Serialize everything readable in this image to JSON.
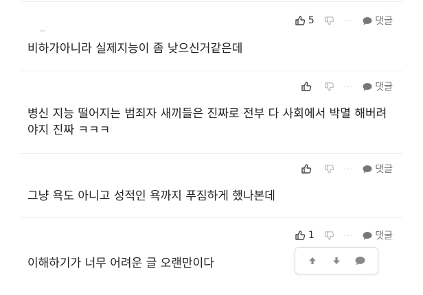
{
  "comments": [
    {
      "like_count": "5",
      "reply_label": "댓글",
      "more_label": "···",
      "text": "비하가아니라 실제지능이 좀 낮으신거같은데"
    },
    {
      "like_count": "",
      "reply_label": "댓글",
      "more_label": "···",
      "text": "병신 지능 떨어지는 범죄자 새끼들은 진짜로 전부 다 사회에서 박멸 해버려야지 진짜 ㅋㅋㅋ"
    },
    {
      "like_count": "",
      "reply_label": "댓글",
      "more_label": "···",
      "text": "그냥 욕도 아니고 성적인 욕까지 푸짐하게 했나본데"
    },
    {
      "like_count": "1",
      "reply_label": "댓글",
      "more_label": "···",
      "text": "이해하기가 너무 어려운 글 오랜만이다"
    }
  ],
  "floating_toolbar": {
    "up": "arrow-up-icon",
    "down": "arrow-down-icon",
    "comment": "comment-bubble-icon"
  },
  "colors": {
    "divider": "#ececec",
    "icon_grey": "#9a9a9a",
    "text": "#222222"
  }
}
